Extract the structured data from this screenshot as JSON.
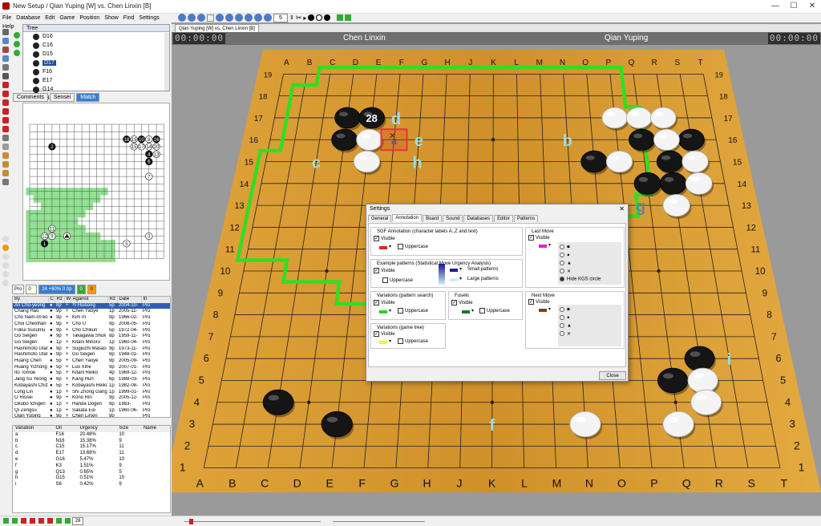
{
  "app": {
    "title": "New Setup / Qian Yuping [W] vs. Chen Linxin [B]",
    "window_controls": [
      "—",
      "☐",
      "✕"
    ]
  },
  "menu": [
    "File",
    "Database",
    "Edit",
    "Game",
    "Position",
    "Show",
    "Find",
    "Settings",
    "Help"
  ],
  "toolbar": {
    "move_number": "5"
  },
  "tree": {
    "title": "Tree",
    "items": [
      "D16",
      "C16",
      "D15",
      "D17",
      "F16",
      "E17",
      "G14",
      "P4"
    ],
    "selected_index": 3
  },
  "panel_tabs": [
    "Comments",
    "Sensei",
    "Match"
  ],
  "minimap": {
    "labels_a": [
      "2",
      "18",
      "10",
      "8",
      "16",
      "7",
      "5",
      "3"
    ],
    "labels_b": [
      "19",
      "15",
      "17",
      "14",
      "20",
      "4",
      "6",
      "13",
      "11",
      "12",
      "9",
      "1"
    ]
  },
  "status_strip": {
    "a": "Pro",
    "b": "24 +60% 0.0p",
    "c": "0",
    "d": "0"
  },
  "games_table": {
    "headers": [
      "By",
      "C",
      "Rz",
      "Wr",
      "Against",
      "Rz",
      "Date",
      "In"
    ],
    "rows": [
      [
        "An Cho-yeong",
        "●",
        "8p",
        "+",
        "Yi Huisong",
        "5p",
        "2004-10-",
        "Pro"
      ],
      [
        "Chang Hao",
        "●",
        "9p",
        "+",
        "Chen Yaoye",
        "1p",
        "2005-11-",
        "Pro"
      ],
      [
        "Cho Nam-ch'eo",
        "●",
        "9p",
        "+",
        "Kim In",
        "9p",
        "1966-02-",
        "Pro"
      ],
      [
        "Choi Cheolhan",
        "●",
        "9p",
        "+",
        "Cho U",
        "9p",
        "2008-05-",
        "Pro"
      ],
      [
        "Fukui Susumu",
        "●",
        "9p",
        "+",
        "Cho Chikun",
        "5p",
        "1972-04-",
        "Pro"
      ],
      [
        "Go Seigen",
        "●",
        "9p",
        "+",
        "Takagawa Shuk",
        "8p",
        "1959-11-",
        "Pro"
      ],
      [
        "Go Seigen",
        "●",
        "1p",
        "+",
        "Kitani Minoru",
        "1p",
        "1960-04-",
        "Pro"
      ],
      [
        "Hashimoto Utar",
        "●",
        "9p",
        "+",
        "Sugiuchi Masao",
        "9p",
        "1973-11-",
        "Pro"
      ],
      [
        "Hashimoto Utar",
        "●",
        "9p",
        "+",
        "Go Seigen",
        "8p",
        "1948-01-",
        "Pro"
      ],
      [
        "Huang Chen",
        "●",
        "5p",
        "+",
        "Chen Yaoye",
        "9p",
        "2005-09-",
        "Pro"
      ],
      [
        "Huang Yizhong",
        "●",
        "5p",
        "+",
        "Luo Xihe",
        "9p",
        "2007-01-",
        "Pro"
      ],
      [
        "Ito Tomoe",
        "●",
        "5p",
        "+",
        "Kitani Reiko",
        "4p",
        "1969-12-",
        "Pro"
      ],
      [
        "Jang Su Yeong",
        "●",
        "6p",
        "+",
        "Kang Hun",
        "6p",
        "1988-03-",
        "Pro"
      ],
      [
        "Kobayashi Chiz",
        "●",
        "5p",
        "+",
        "Kobayashi Reiko",
        "1p",
        "1982-08-",
        "Pro"
      ],
      [
        "Long Lin",
        "●",
        "1p",
        "+",
        "Shi Zhong Gang",
        "1p",
        "1999-01-",
        "Pro"
      ],
      [
        "O Rissei",
        "●",
        "9p",
        "+",
        "Kono Rin",
        "9p",
        "2005-12-",
        "Pro"
      ],
      [
        "Okubo Ichigen",
        "●",
        "1p",
        "+",
        "Handa Dogen",
        "9p",
        "1983-",
        "Pro"
      ],
      [
        "Qi Zengsu",
        "●",
        "1p",
        "+",
        "Sakata Eio",
        "1p",
        "1960-06-",
        "Pro"
      ],
      [
        "Qian Yuping",
        "●",
        "9p",
        "+",
        "Chen Linxin",
        "9p",
        "",
        "Pro"
      ]
    ]
  },
  "variation_table": {
    "headers": [
      "Variation",
      "On",
      "Urgency",
      "Size",
      "Name"
    ],
    "rows": [
      [
        "a",
        "F16",
        "20.48%",
        "10"
      ],
      [
        "b",
        "N16",
        "15.38%",
        "9"
      ],
      [
        "c",
        "C15",
        "15.17%",
        "11"
      ],
      [
        "d",
        "E17",
        "13.68%",
        "11"
      ],
      [
        "e",
        "G16",
        "5.47%",
        "10"
      ],
      [
        "f",
        "K3",
        "1.51%",
        "9"
      ],
      [
        "g",
        "Q13",
        "0.65%",
        "5"
      ],
      [
        "h",
        "G15",
        "0.51%",
        "10"
      ],
      [
        "i",
        "S6",
        "0.42%",
        "9"
      ]
    ]
  },
  "game_tab": {
    "label": "Qian Yuping [W] vs. Chen Linxin [B]"
  },
  "players": {
    "black": "Chen Linxin",
    "white": "Qian Yuping",
    "clock_black": "00:00:00",
    "clock_white": "00:00:00"
  },
  "board": {
    "cols": [
      "A",
      "B",
      "C",
      "D",
      "E",
      "F",
      "G",
      "H",
      "J",
      "K",
      "L",
      "M",
      "N",
      "O",
      "P",
      "Q",
      "R",
      "S",
      "T"
    ],
    "rows": [
      "19",
      "18",
      "17",
      "16",
      "15",
      "14",
      "13",
      "12",
      "11",
      "10",
      "9",
      "8",
      "7",
      "6",
      "5",
      "4",
      "3",
      "2",
      "1"
    ],
    "last_move_number": "28",
    "markers": [
      "a",
      "b",
      "c",
      "d",
      "e",
      "f",
      "g",
      "h",
      "i"
    ]
  },
  "settings": {
    "title": "Settings",
    "close_x": "✕",
    "tabs": [
      "General",
      "Annotation",
      "Board",
      "Sound",
      "Databases",
      "Editor",
      "Patterns"
    ],
    "active_tab": "Annotation",
    "sgf": {
      "title": "SGF Annotation (character labels A..Z and text)",
      "visible": "Visible",
      "uppercase": "Uppercase",
      "color": "#e8202a"
    },
    "example": {
      "title": "Example patterns (Statistical Move Urgency Analysis)",
      "visible": "Visible",
      "uppercase": "Uppercase",
      "small": "Small patterns",
      "large": "Large patterns",
      "color_small": "#1c1c8c",
      "color_large": "#cfeefa"
    },
    "var_search": {
      "title": "Variations (pattern search)",
      "visible": "Visible",
      "uppercase": "Uppercase",
      "color": "#28d028"
    },
    "fuseki": {
      "title": "Fuseki",
      "visible": "Visible",
      "uppercase": "Uppercase",
      "color": "#1c7a1c"
    },
    "var_tree": {
      "title": "Variations (game tree)",
      "visible": "Visible",
      "uppercase": "Uppercase",
      "color": "#f4f428"
    },
    "last_move": {
      "title": "Last Move",
      "visible": "Visible",
      "color": "#e020d0",
      "options": [
        "■",
        "●",
        "▲",
        "✕",
        "Hide KGS circle"
      ]
    },
    "next_move": {
      "title": "Next Move",
      "visible": "Visible",
      "color": "#8c3c14",
      "options": [
        "■",
        "●",
        "▲",
        "✕"
      ]
    },
    "close_button": "Close"
  },
  "bottom": {
    "move_field": "28"
  }
}
